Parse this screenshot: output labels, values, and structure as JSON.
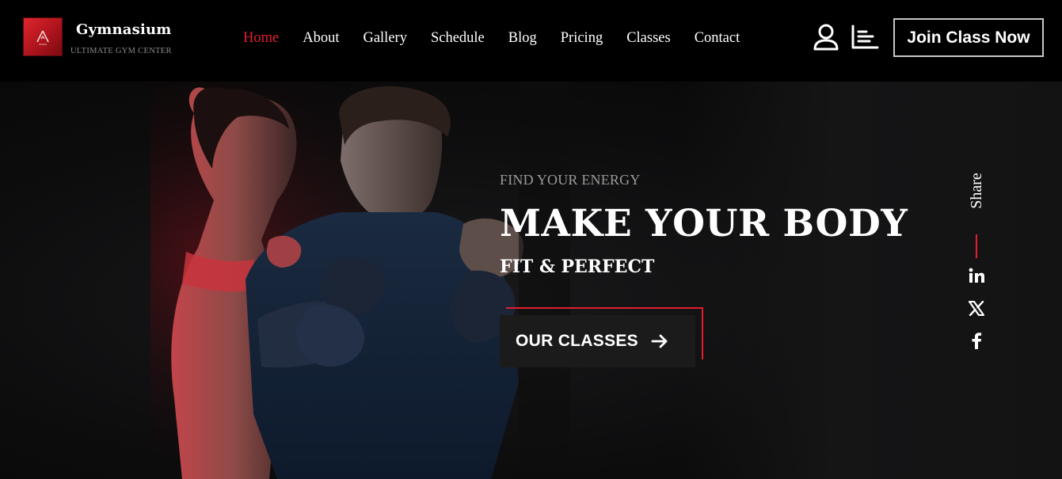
{
  "brand": {
    "name": "Gymnasium",
    "tagline": "ULTIMATE GYM CENTER",
    "logo_color": "#c41a24"
  },
  "nav": {
    "items": [
      {
        "label": "Home",
        "active": true
      },
      {
        "label": "About",
        "active": false
      },
      {
        "label": "Gallery",
        "active": false
      },
      {
        "label": "Schedule",
        "active": false
      },
      {
        "label": "Blog",
        "active": false
      },
      {
        "label": "Pricing",
        "active": false
      },
      {
        "label": "Classes",
        "active": false
      },
      {
        "label": "Contact",
        "active": false
      }
    ],
    "active_color": "#e21d2f"
  },
  "header_actions": {
    "user_icon": "user-icon",
    "menu_icon": "bars-left-icon",
    "join_label": "Join Class Now"
  },
  "hero": {
    "eyebrow": "FIND YOUR ENERGY",
    "headline": "MAKE YOUR BODY",
    "subhead": "FIT & PERFECT",
    "cta_label": "OUR CLASSES",
    "cta_icon": "arrow-right-icon",
    "accent_color": "#e21d2f",
    "image": "two-athletes-boxing-stance"
  },
  "share": {
    "label": "Share",
    "networks": [
      {
        "name": "linkedin",
        "icon": "linkedin-icon"
      },
      {
        "name": "x",
        "icon": "x-icon"
      },
      {
        "name": "facebook",
        "icon": "facebook-icon"
      }
    ]
  }
}
